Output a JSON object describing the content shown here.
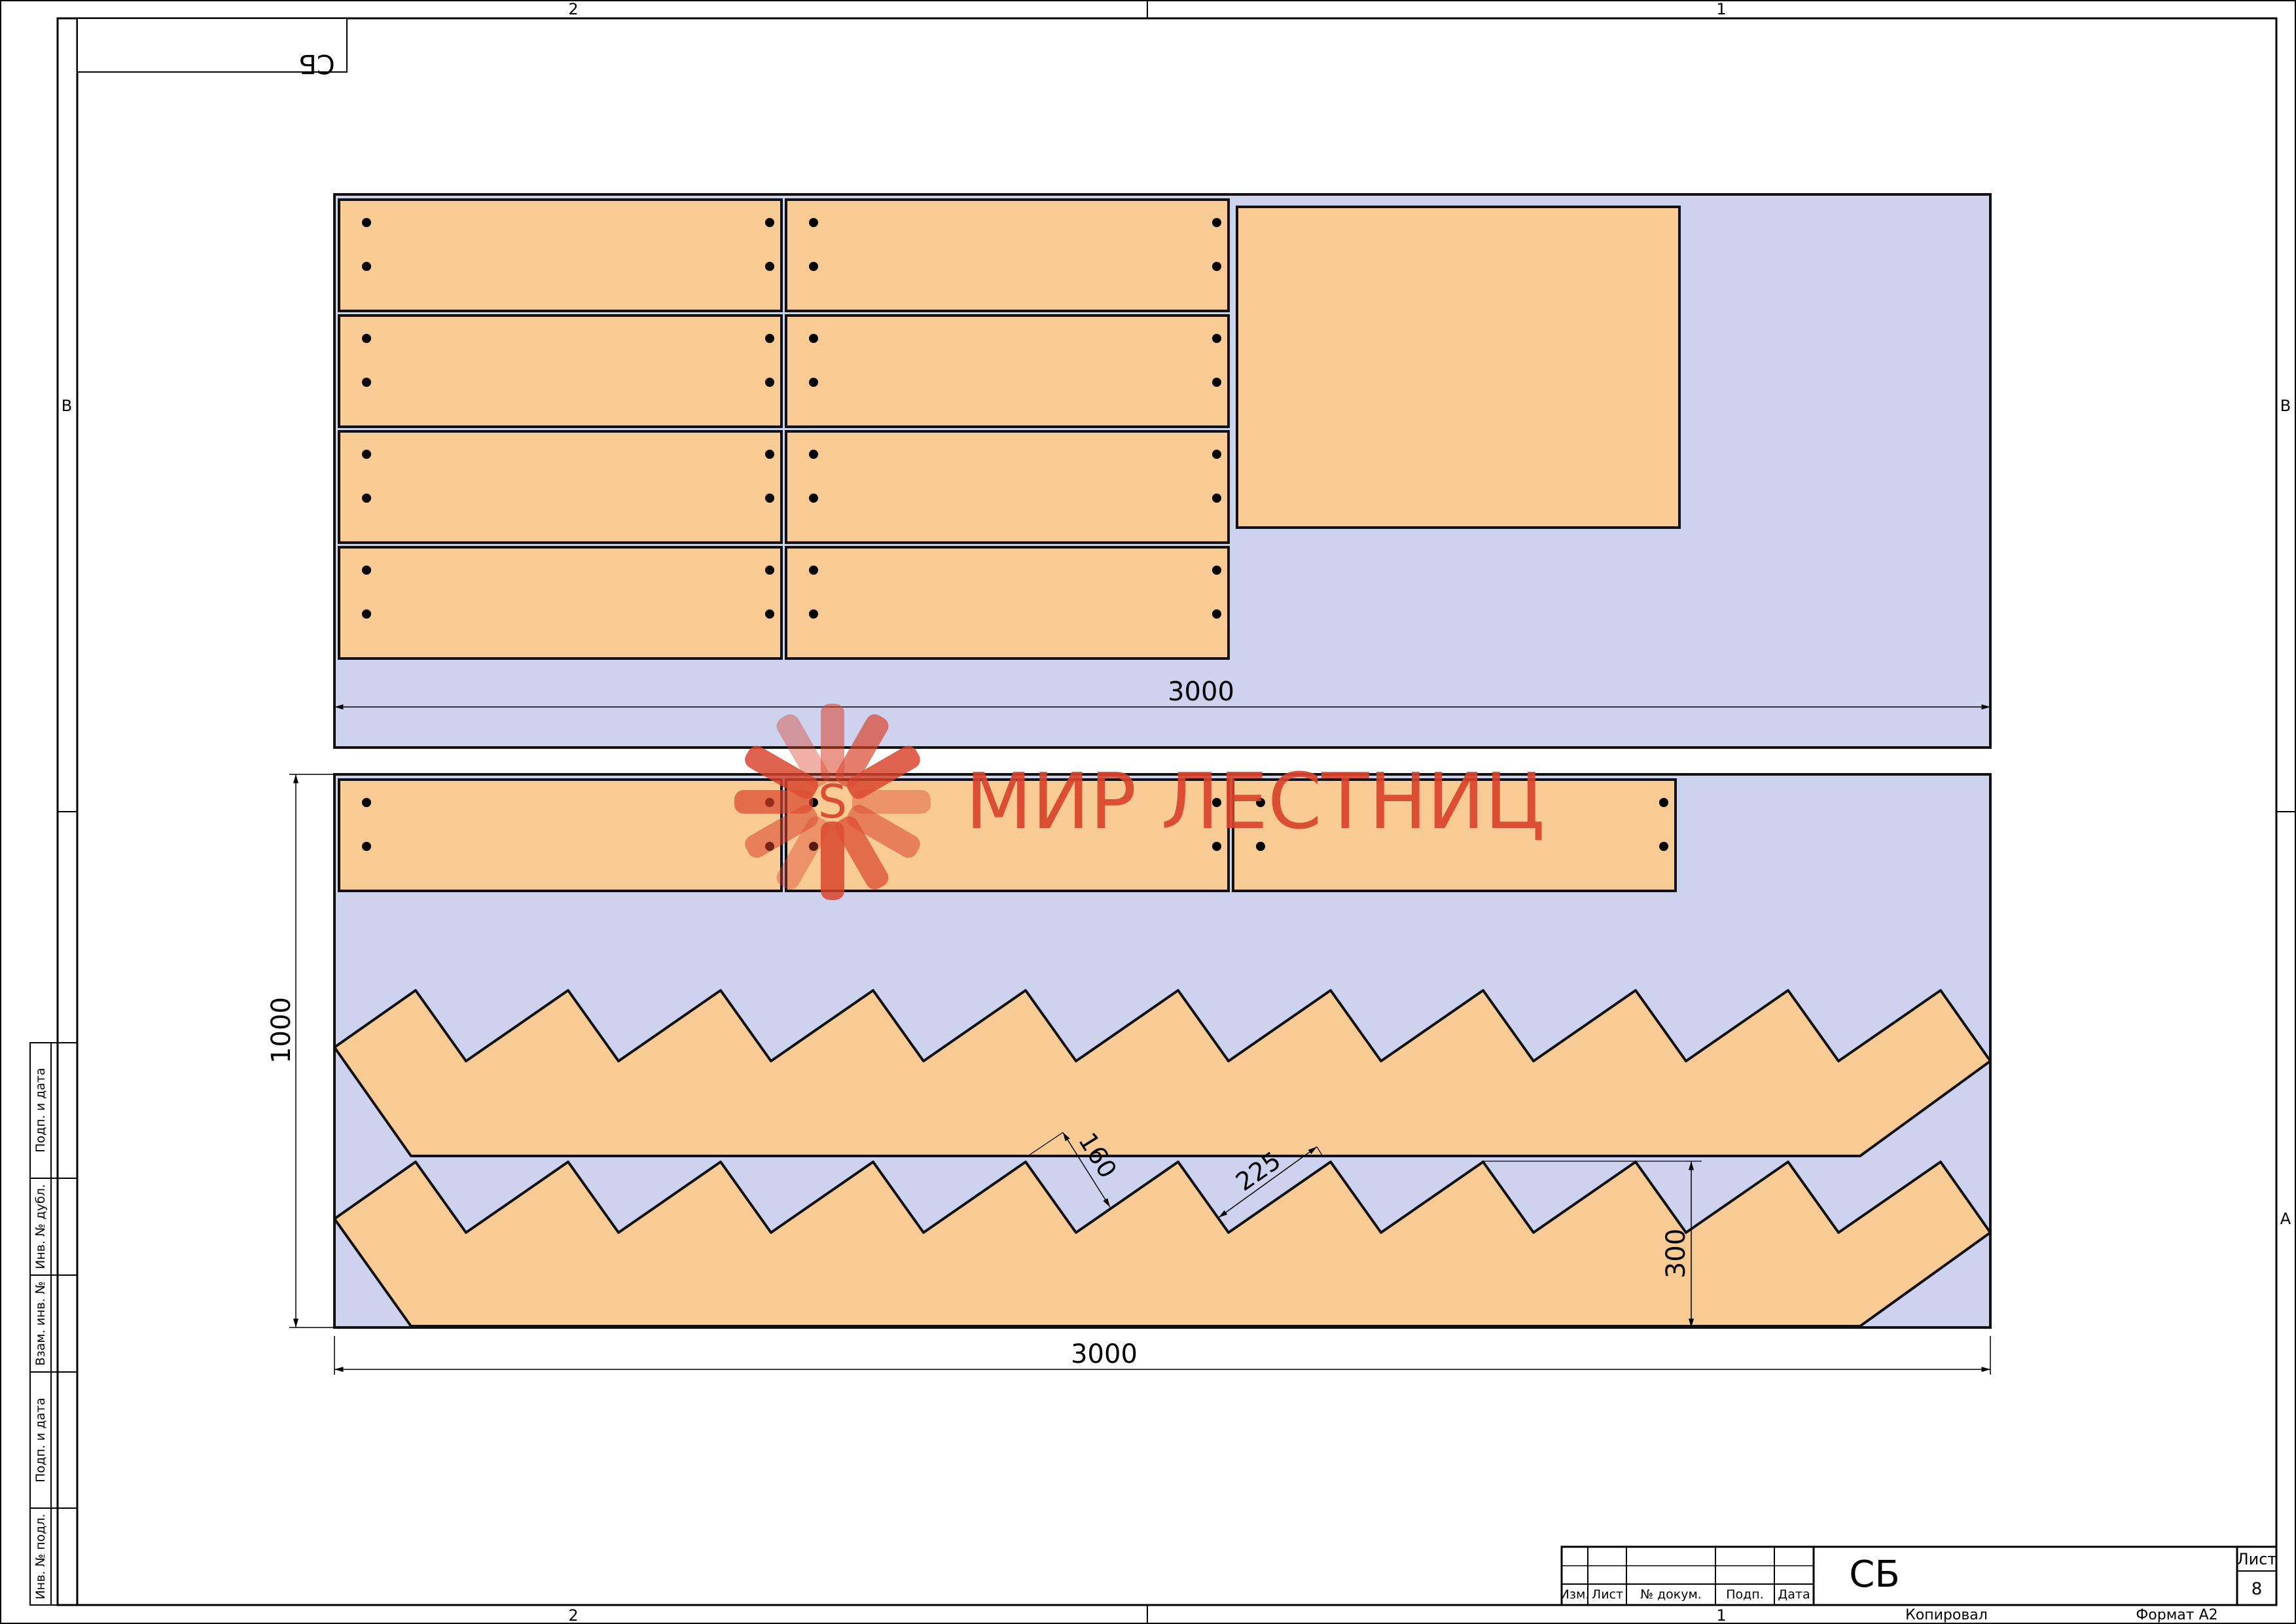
{
  "frame": {
    "top_zones": [
      "2",
      "1"
    ],
    "bottom_zones": [
      "2",
      "1"
    ],
    "left_zone": "B",
    "right_zones": [
      "B",
      "A"
    ]
  },
  "stamp": {
    "mirrored_code": "СБ"
  },
  "side_stamp": [
    "Подп. и дата",
    "Инв. № дубл.",
    "Взам. инв. №",
    "Подп. и дата",
    "Инв. № подл."
  ],
  "drawing": {
    "sheet1": {
      "width_dim": "3000"
    },
    "sheet2": {
      "width_dim": "3000",
      "height_dim": "1000",
      "step_depth_dim": "160",
      "step_width_dim": "225",
      "stringer_height_dim": "300"
    },
    "colors": {
      "sheet": "#cdd2ee",
      "part": "#f8ca94",
      "outline": "#111111"
    }
  },
  "watermark": {
    "text": "МИР ЛЕСТНИЦ",
    "color": "#d9432b"
  },
  "title_block": {
    "headers": [
      "Изм.",
      "Лист",
      "№ докум.",
      "Подп.",
      "Дата"
    ],
    "designation": "СБ",
    "sheet_label": "Лист",
    "sheet_number": "8",
    "copied_label": "Копировал",
    "format_label": "Формат А2"
  }
}
